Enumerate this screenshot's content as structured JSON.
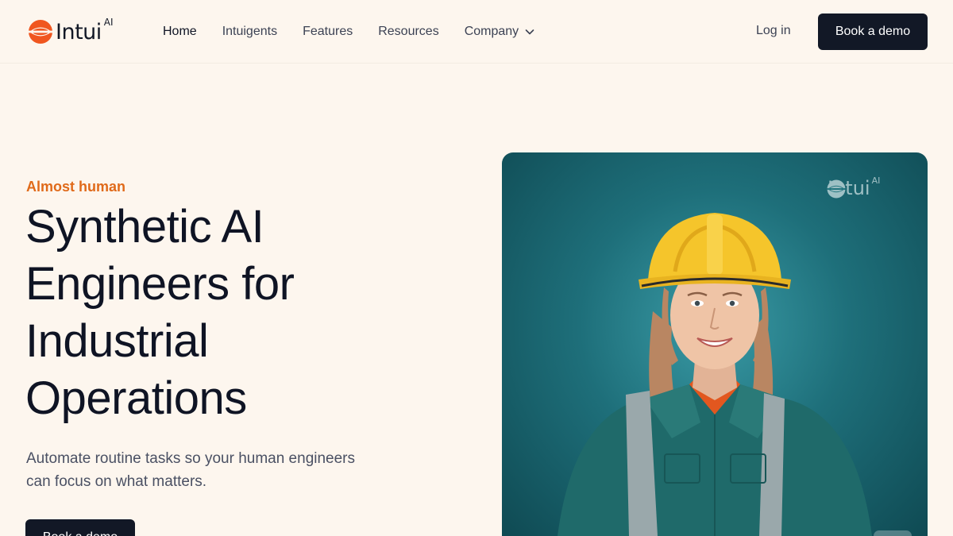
{
  "brand": {
    "name": "Intui",
    "superscript": "AI",
    "logo_icon": "intui-logo-icon"
  },
  "nav": {
    "items": [
      {
        "label": "Home",
        "active": true
      },
      {
        "label": "Intuigents",
        "active": false
      },
      {
        "label": "Features",
        "active": false
      },
      {
        "label": "Resources",
        "active": false
      }
    ],
    "company_label": "Company",
    "company_icon": "chevron-down-icon",
    "login_label": "Log in",
    "cta_label": "Book a demo"
  },
  "hero": {
    "eyebrow": "Almost human",
    "headline_lines": [
      "Synthetic AI",
      "Engineers for",
      "Industrial",
      "Operations"
    ],
    "subtext_lines": [
      "Automate routine tasks so your human engineers",
      "can focus on what matters."
    ],
    "cta_label": "Book a demo",
    "image_alt": "Smiling female engineer in yellow hard hat and teal coveralls",
    "watermark": {
      "name": "Intui",
      "superscript": "AI"
    }
  },
  "colors": {
    "background": "#fdf6ee",
    "accent": "#e06a1a",
    "button": "#121826",
    "text": "#0f1424"
  }
}
